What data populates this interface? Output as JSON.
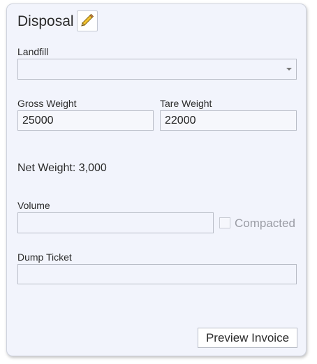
{
  "panel": {
    "title": "Disposal",
    "edit_icon": "pencil-icon"
  },
  "landfill": {
    "label": "Landfill",
    "value": ""
  },
  "gross_weight": {
    "label": "Gross Weight",
    "value": "25000"
  },
  "tare_weight": {
    "label": "Tare Weight",
    "value": "22000"
  },
  "net_weight": {
    "text": "Net Weight: 3,000"
  },
  "volume": {
    "label": "Volume",
    "value": ""
  },
  "compacted": {
    "label": "Compacted",
    "checked": false
  },
  "dump_ticket": {
    "label": "Dump Ticket",
    "value": ""
  },
  "actions": {
    "preview_invoice": "Preview Invoice"
  }
}
